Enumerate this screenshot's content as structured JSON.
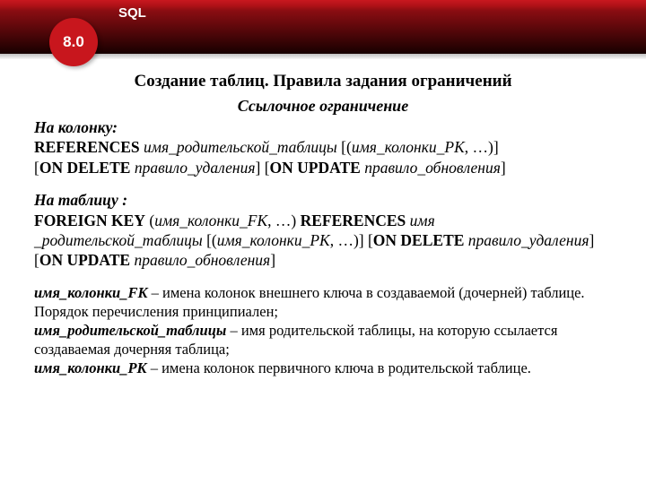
{
  "header": {
    "sql_label": "SQL",
    "badge": "8.0"
  },
  "title": "Создание таблиц. Правила задания ограничений",
  "subtitle": "Ссылочное ограничение",
  "column": {
    "lead": "На колонку:",
    "kw_references": "REFERENCES",
    "parent_table": "имя_родительской_таблицы",
    "pk_cols": "имя_колонки_PK",
    "ellipsis": ", …",
    "kw_on_delete": "ON DELETE",
    "delete_rule": "правило_удаления",
    "kw_on_update": "ON UPDATE",
    "update_rule": "правило_обновления"
  },
  "table": {
    "lead": "На таблицу :",
    "kw_fk": "FOREIGN KEY",
    "fk_cols": "имя_колонки_FK",
    "ellipsis1": ", …",
    "kw_references": "REFERENCES",
    "parent_table_1": "имя",
    "parent_table_2": "_родительской_таблицы",
    "pk_cols": "имя_колонки_PK",
    "ellipsis2": ", …",
    "kw_on_delete": "ON DELETE",
    "delete_rule": "правило_удаления",
    "kw_on_update": "ON UPDATE",
    "update_rule": "правило_обновления"
  },
  "defs": {
    "d1_term": "имя_колонки_FK",
    "d1_text": " – имена колонок внешнего ключа в создаваемой (дочерней) таблице. Порядок перечисления принципиален;",
    "d2_term": "имя_родительской_таблицы",
    "d2_text": " – имя родительской таблицы, на которую ссылается создаваемая дочерняя таблица;",
    "d3_term": "имя_колонки_PK",
    "d3_text": " – имена колонок первичного ключа в родительской таблице."
  }
}
